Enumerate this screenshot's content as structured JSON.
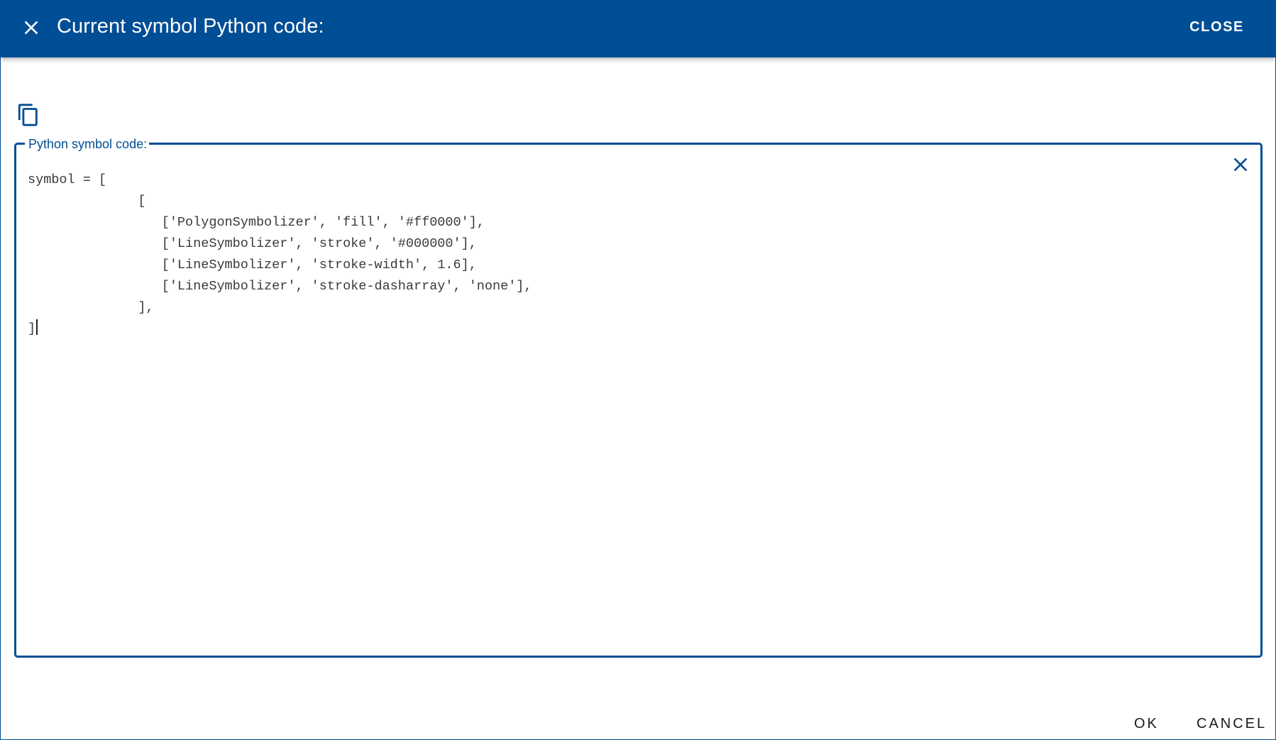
{
  "dialog": {
    "title": "Current symbol Python code:",
    "close_label": "CLOSE",
    "close_icon": "close-icon",
    "accent_color": "#004e95"
  },
  "editor": {
    "copy_icon": "copy-icon",
    "clear_icon": "close-icon",
    "label": "Python symbol code:",
    "code_lines": [
      "symbol = [",
      "              [",
      "                 ['PolygonSymbolizer', 'fill', '#ff0000'],",
      "                 ['LineSymbolizer', 'stroke', '#000000'],",
      "                 ['LineSymbolizer', 'stroke-width', 1.6],",
      "                 ['LineSymbolizer', 'stroke-dasharray', 'none'],",
      "              ],",
      "]"
    ]
  },
  "actions": {
    "ok_label": "OK",
    "cancel_label": "CANCEL"
  }
}
